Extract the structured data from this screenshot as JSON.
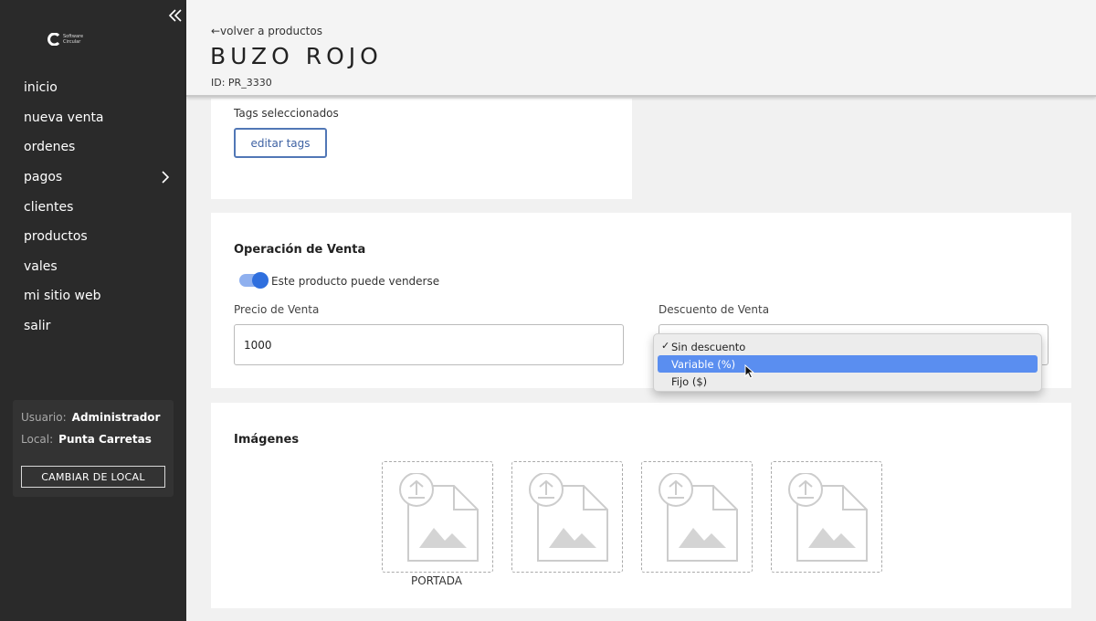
{
  "sidebar": {
    "logo_line1": "Software",
    "logo_line2": "Circular",
    "items": [
      {
        "label": "inicio"
      },
      {
        "label": "nueva venta"
      },
      {
        "label": "ordenes"
      },
      {
        "label": "pagos"
      },
      {
        "label": "clientes"
      },
      {
        "label": "productos"
      },
      {
        "label": "vales"
      },
      {
        "label": "mi sitio web"
      },
      {
        "label": "salir"
      }
    ],
    "user_label": "Usuario:",
    "user_value": "Administrador",
    "local_label": "Local:",
    "local_value": "Punta Carretas",
    "change_local_button": "CAMBIAR DE LOCAL"
  },
  "header": {
    "back_link": "←volver a productos",
    "title": "BUZO ROJO",
    "product_id": "ID: PR_3330"
  },
  "tags": {
    "label": "Tags seleccionados",
    "edit_button": "editar tags"
  },
  "venta": {
    "title": "Operación de Venta",
    "toggle_label": "Este producto puede venderse",
    "toggle_on": true,
    "price_label": "Precio de Venta",
    "price_value": "1000",
    "discount_label": "Descuento de Venta",
    "discount_options": [
      {
        "label": "Sin descuento",
        "selected": true
      },
      {
        "label": "Variable (%)",
        "highlighted": true
      },
      {
        "label": "Fijo ($)"
      }
    ]
  },
  "images": {
    "title": "Imágenes",
    "cover_caption": "PORTADA"
  },
  "colors": {
    "sidebar_bg": "#2a2a2a",
    "accent": "#2f6fde",
    "button_border": "#5177b6",
    "dropdown_highlight": "#5a8ef0"
  }
}
